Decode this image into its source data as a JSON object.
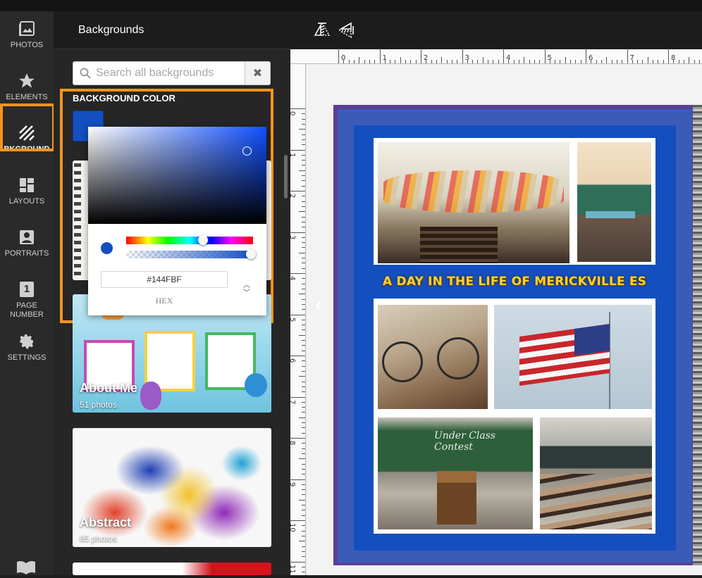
{
  "sidebar": {
    "items": [
      {
        "label": "PHOTOS",
        "icon": "photos-icon"
      },
      {
        "label": "ELEMENTS",
        "icon": "star-icon"
      },
      {
        "label": "BKGROUND",
        "icon": "background-stripes-icon"
      },
      {
        "label": "LAYOUTS",
        "icon": "layouts-icon"
      },
      {
        "label": "PORTRAITS",
        "icon": "portrait-icon"
      },
      {
        "label": "PAGE NUMBER",
        "icon": "page-number-icon",
        "icon_text": "1"
      },
      {
        "label": "SETTINGS",
        "icon": "gear-icon"
      }
    ],
    "active": "BKGROUND",
    "bottom_icon": "book-icon"
  },
  "panel": {
    "title": "Backgrounds",
    "search": {
      "placeholder": "Search all backgrounds",
      "value": ""
    },
    "background_color": {
      "label": "BACKGROUND COLOR",
      "value": "#144FBF"
    },
    "cards": [
      {
        "title": "About Me",
        "subtitle": "51 photos"
      },
      {
        "title": "Abstract",
        "subtitle": "85 photos"
      }
    ]
  },
  "color_picker": {
    "hex_value": "#144FBF",
    "mode_label": "HEX",
    "hue_position": 0.61,
    "alpha": 1.0
  },
  "toolbar": {
    "buttons": [
      "flip-horizontal-icon",
      "flip-vertical-icon"
    ]
  },
  "rulers": {
    "horizontal": [
      "0",
      "1",
      "2",
      "3",
      "4",
      "5",
      "6",
      "7",
      "8"
    ],
    "vertical": [
      "0",
      "1",
      "2",
      "3",
      "4",
      "5",
      "6",
      "7",
      "8",
      "9",
      "10",
      "11"
    ]
  },
  "page": {
    "headline": "A DAY IN THE LIFE OF MERICKVILLE ES",
    "chalkboard_text": "Under Class Contest",
    "background_color": "#144FBF"
  },
  "colors": {
    "accent_highlight": "#f7941d",
    "panel_bg": "#262626",
    "nav_bg": "#2a2a2a"
  }
}
